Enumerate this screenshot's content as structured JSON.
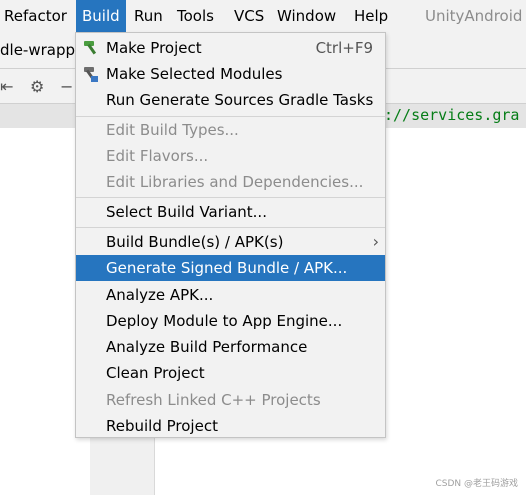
{
  "menubar": {
    "refactor": "Refactor",
    "build": "Build",
    "run": "Run",
    "tools": "Tools",
    "vcs": "VCS",
    "window": "Window",
    "help": "Help",
    "app_title": "UnityAndroid"
  },
  "tab": {
    "label": "dle-wrapp"
  },
  "editor": {
    "code_text": "://services.gra"
  },
  "build_menu": {
    "make_project": "Make Project",
    "make_project_shortcut": "Ctrl+F9",
    "make_selected_modules": "Make Selected Modules",
    "run_generate_sources": "Run Generate Sources Gradle Tasks",
    "edit_build_types": "Edit Build Types...",
    "edit_flavors": "Edit Flavors...",
    "edit_libraries": "Edit Libraries and Dependencies...",
    "select_build_variant": "Select Build Variant...",
    "build_bundles_apks": "Build Bundle(s) / APK(s)",
    "generate_signed": "Generate Signed Bundle / APK...",
    "analyze_apk": "Analyze APK...",
    "deploy_module": "Deploy Module to App Engine...",
    "analyze_build_performance": "Analyze Build Performance",
    "clean_project": "Clean Project",
    "refresh_linked_cpp": "Refresh Linked C++ Projects",
    "rebuild_project": "Rebuild Project"
  },
  "watermark": "CSDN @老王码游戏",
  "colors": {
    "accent": "#2675bf",
    "menu_bg": "#f2f2f2",
    "code_green": "#067d17"
  }
}
